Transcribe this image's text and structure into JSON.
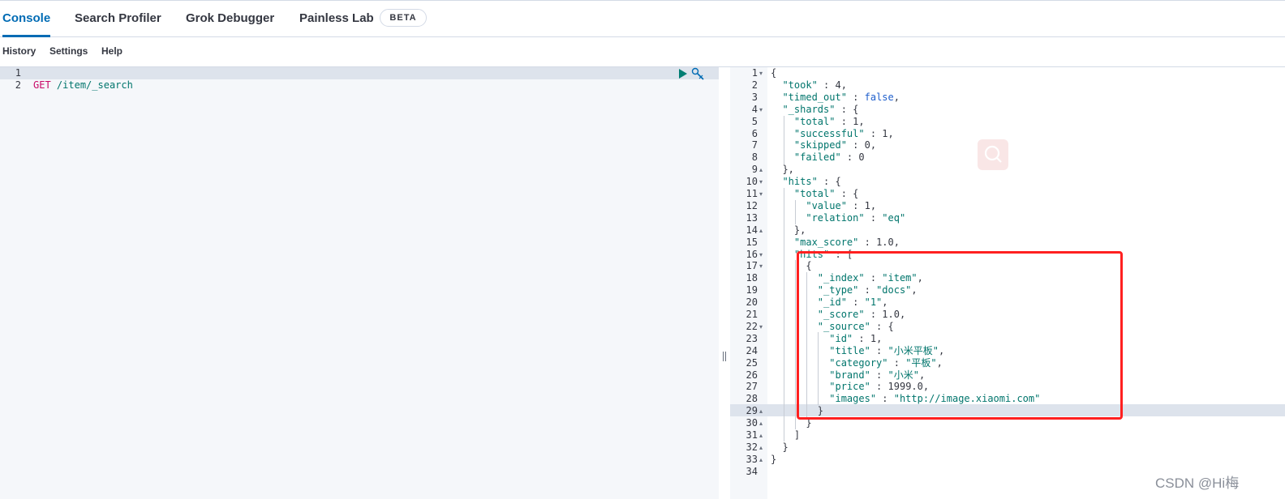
{
  "tabs": [
    {
      "label": "Console",
      "active": true
    },
    {
      "label": "Search Profiler",
      "active": false
    },
    {
      "label": "Grok Debugger",
      "active": false
    },
    {
      "label": "Painless Lab",
      "active": false
    }
  ],
  "badge": "BETA",
  "menu": [
    "History",
    "Settings",
    "Help"
  ],
  "request": {
    "line_numbers": [
      "1",
      "2"
    ],
    "method": "GET",
    "path": "/item/_search"
  },
  "response": {
    "line_numbers": [
      "1",
      "2",
      "3",
      "4",
      "5",
      "6",
      "7",
      "8",
      "9",
      "10",
      "11",
      "12",
      "13",
      "14",
      "15",
      "16",
      "17",
      "18",
      "19",
      "20",
      "21",
      "22",
      "23",
      "24",
      "25",
      "26",
      "27",
      "28",
      "29",
      "30",
      "31",
      "32",
      "33",
      "34"
    ],
    "fold_markers": {
      "1": "▾",
      "4": "▾",
      "9": "▴",
      "10": "▾",
      "11": "▾",
      "14": "▴",
      "16": "▾",
      "17": "▾",
      "22": "▾",
      "29": "▴",
      "30": "▴",
      "31": "▴",
      "32": "▴",
      "33": "▴"
    },
    "lines": [
      [
        [
          "p",
          "{"
        ]
      ],
      [
        [
          "p",
          "  "
        ],
        [
          "k",
          "\"took\""
        ],
        [
          "p",
          " : "
        ],
        [
          "n",
          "4"
        ],
        [
          "p",
          ","
        ]
      ],
      [
        [
          "p",
          "  "
        ],
        [
          "k",
          "\"timed_out\""
        ],
        [
          "p",
          " : "
        ],
        [
          "b",
          "false"
        ],
        [
          "p",
          ","
        ]
      ],
      [
        [
          "p",
          "  "
        ],
        [
          "k",
          "\"_shards\""
        ],
        [
          "p",
          " : {"
        ]
      ],
      [
        [
          "p",
          "    "
        ],
        [
          "k",
          "\"total\""
        ],
        [
          "p",
          " : "
        ],
        [
          "n",
          "1"
        ],
        [
          "p",
          ","
        ]
      ],
      [
        [
          "p",
          "    "
        ],
        [
          "k",
          "\"successful\""
        ],
        [
          "p",
          " : "
        ],
        [
          "n",
          "1"
        ],
        [
          "p",
          ","
        ]
      ],
      [
        [
          "p",
          "    "
        ],
        [
          "k",
          "\"skipped\""
        ],
        [
          "p",
          " : "
        ],
        [
          "n",
          "0"
        ],
        [
          "p",
          ","
        ]
      ],
      [
        [
          "p",
          "    "
        ],
        [
          "k",
          "\"failed\""
        ],
        [
          "p",
          " : "
        ],
        [
          "n",
          "0"
        ]
      ],
      [
        [
          "p",
          "  },"
        ]
      ],
      [
        [
          "p",
          "  "
        ],
        [
          "k",
          "\"hits\""
        ],
        [
          "p",
          " : {"
        ]
      ],
      [
        [
          "p",
          "    "
        ],
        [
          "k",
          "\"total\""
        ],
        [
          "p",
          " : {"
        ]
      ],
      [
        [
          "p",
          "      "
        ],
        [
          "k",
          "\"value\""
        ],
        [
          "p",
          " : "
        ],
        [
          "n",
          "1"
        ],
        [
          "p",
          ","
        ]
      ],
      [
        [
          "p",
          "      "
        ],
        [
          "k",
          "\"relation\""
        ],
        [
          "p",
          " : "
        ],
        [
          "s",
          "\"eq\""
        ]
      ],
      [
        [
          "p",
          "    },"
        ]
      ],
      [
        [
          "p",
          "    "
        ],
        [
          "k",
          "\"max_score\""
        ],
        [
          "p",
          " : "
        ],
        [
          "n",
          "1.0"
        ],
        [
          "p",
          ","
        ]
      ],
      [
        [
          "p",
          "    "
        ],
        [
          "k",
          "\"hits\""
        ],
        [
          "p",
          " : ["
        ]
      ],
      [
        [
          "p",
          "      {"
        ]
      ],
      [
        [
          "p",
          "        "
        ],
        [
          "k",
          "\"_index\""
        ],
        [
          "p",
          " : "
        ],
        [
          "s",
          "\"item\""
        ],
        [
          "p",
          ","
        ]
      ],
      [
        [
          "p",
          "        "
        ],
        [
          "k",
          "\"_type\""
        ],
        [
          "p",
          " : "
        ],
        [
          "s",
          "\"docs\""
        ],
        [
          "p",
          ","
        ]
      ],
      [
        [
          "p",
          "        "
        ],
        [
          "k",
          "\"_id\""
        ],
        [
          "p",
          " : "
        ],
        [
          "s",
          "\"1\""
        ],
        [
          "p",
          ","
        ]
      ],
      [
        [
          "p",
          "        "
        ],
        [
          "k",
          "\"_score\""
        ],
        [
          "p",
          " : "
        ],
        [
          "n",
          "1.0"
        ],
        [
          "p",
          ","
        ]
      ],
      [
        [
          "p",
          "        "
        ],
        [
          "k",
          "\"_source\""
        ],
        [
          "p",
          " : {"
        ]
      ],
      [
        [
          "p",
          "          "
        ],
        [
          "k",
          "\"id\""
        ],
        [
          "p",
          " : "
        ],
        [
          "n",
          "1"
        ],
        [
          "p",
          ","
        ]
      ],
      [
        [
          "p",
          "          "
        ],
        [
          "k",
          "\"title\""
        ],
        [
          "p",
          " : "
        ],
        [
          "s",
          "\"小米平板\""
        ],
        [
          "p",
          ","
        ]
      ],
      [
        [
          "p",
          "          "
        ],
        [
          "k",
          "\"category\""
        ],
        [
          "p",
          " : "
        ],
        [
          "s",
          "\"平板\""
        ],
        [
          "p",
          ","
        ]
      ],
      [
        [
          "p",
          "          "
        ],
        [
          "k",
          "\"brand\""
        ],
        [
          "p",
          " : "
        ],
        [
          "s",
          "\"小米\""
        ],
        [
          "p",
          ","
        ]
      ],
      [
        [
          "p",
          "          "
        ],
        [
          "k",
          "\"price\""
        ],
        [
          "p",
          " : "
        ],
        [
          "n",
          "1999.0"
        ],
        [
          "p",
          ","
        ]
      ],
      [
        [
          "p",
          "          "
        ],
        [
          "k",
          "\"images\""
        ],
        [
          "p",
          " : "
        ],
        [
          "s",
          "\"http://image.xiaomi.com\""
        ]
      ],
      [
        [
          "p",
          "        }"
        ]
      ],
      [
        [
          "p",
          "      }"
        ]
      ],
      [
        [
          "p",
          "    ]"
        ]
      ],
      [
        [
          "p",
          "  }"
        ]
      ],
      [
        [
          "p",
          "}"
        ]
      ],
      [
        [
          "p",
          ""
        ]
      ]
    ]
  },
  "watermark": "CSDN @Hi梅",
  "colors": {
    "accent": "#006bb4",
    "highlight_box": "#ff2020"
  }
}
